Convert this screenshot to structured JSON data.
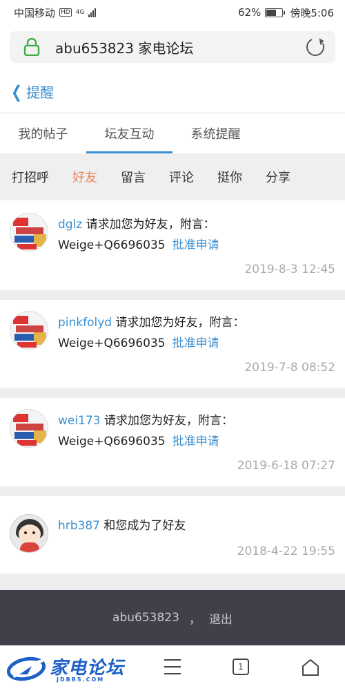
{
  "status_bar": {
    "carrier": "中国移动",
    "network_badge": "HD",
    "network_type": "4G",
    "battery_percent": "62%",
    "battery_level": 0.62,
    "time": "傍晚5:06"
  },
  "browser": {
    "url_title": "abu653823 家电论坛",
    "lock_icon": "lock-icon",
    "refresh_icon": "refresh-icon"
  },
  "header": {
    "back_icon": "chevron-left-icon",
    "title": "提醒"
  },
  "tabs": [
    {
      "label": "我的帖子",
      "active": false
    },
    {
      "label": "坛友互动",
      "active": true
    },
    {
      "label": "系统提醒",
      "active": false
    }
  ],
  "subtabs": [
    {
      "label": "打招呼",
      "active": false
    },
    {
      "label": "好友",
      "active": true
    },
    {
      "label": "留言",
      "active": false
    },
    {
      "label": "评论",
      "active": false
    },
    {
      "label": "挺你",
      "active": false
    },
    {
      "label": "分享",
      "active": false
    }
  ],
  "notifications": [
    {
      "user": "dglz",
      "text": "请求加您为好友，附言：",
      "message": "Weige+Q6696035",
      "action": "批准申请",
      "time": "2019-8-3 12:45"
    },
    {
      "user": "pinkfolyd",
      "text": "请求加您为好友，附言：",
      "message": "Weige+Q6696035",
      "action": "批准申请",
      "time": "2019-7-8 08:52"
    },
    {
      "user": "wei173",
      "text": "请求加您为好友，附言：",
      "message": "Weige+Q6696035",
      "action": "批准申请",
      "time": "2019-6-18 07:27"
    },
    {
      "user": "hrb387",
      "text": "和您成为了好友",
      "time": "2018-4-22 19:55"
    }
  ],
  "footer": {
    "username": "abu653823",
    "separator": "，",
    "logout": "退出"
  },
  "bottom_bar": {
    "logo_text": "家电论坛",
    "logo_sub": "JDBBS.COM",
    "tab_count": "1"
  },
  "colors": {
    "accent": "#3a8fd0",
    "active_subtab": "#e8835a",
    "footer_bg": "#41404a"
  }
}
